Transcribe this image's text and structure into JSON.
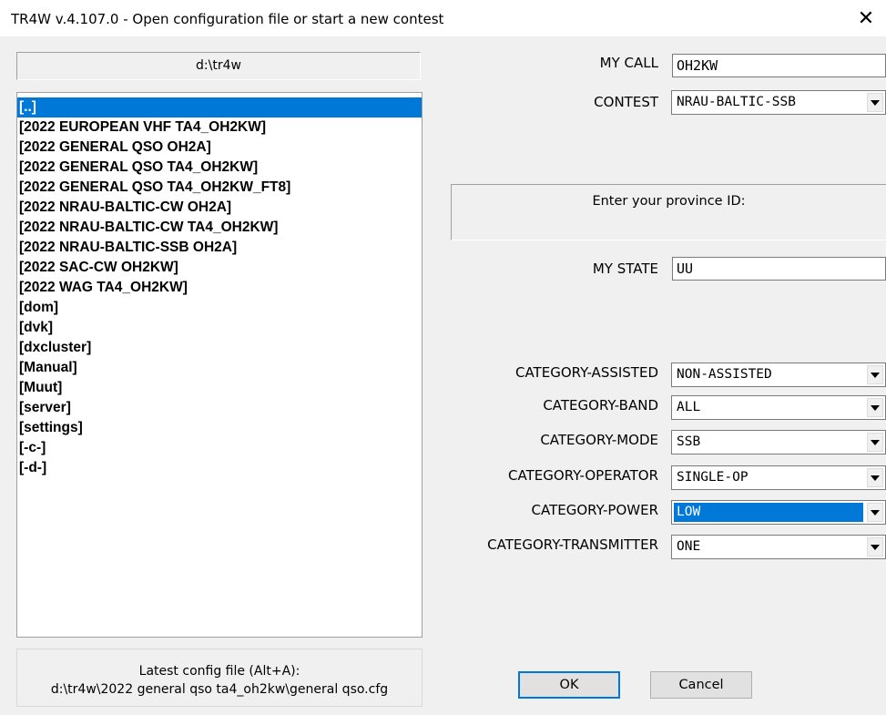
{
  "window": {
    "title": "TR4W v.4.107.0 - Open configuration file or start a new contest"
  },
  "path": "d:\\tr4w",
  "files": [
    {
      "name": "[..]",
      "selected": true
    },
    {
      "name": "[2022 EUROPEAN VHF TA4_OH2KW]",
      "selected": false
    },
    {
      "name": "[2022 GENERAL QSO OH2A]",
      "selected": false
    },
    {
      "name": "[2022 GENERAL QSO TA4_OH2KW]",
      "selected": false
    },
    {
      "name": "[2022 GENERAL QSO TA4_OH2KW_FT8]",
      "selected": false
    },
    {
      "name": "[2022 NRAU-BALTIC-CW OH2A]",
      "selected": false
    },
    {
      "name": "[2022 NRAU-BALTIC-CW TA4_OH2KW]",
      "selected": false
    },
    {
      "name": "[2022 NRAU-BALTIC-SSB OH2A]",
      "selected": false
    },
    {
      "name": "[2022 SAC-CW OH2KW]",
      "selected": false
    },
    {
      "name": "[2022 WAG TA4_OH2KW]",
      "selected": false
    },
    {
      "name": "[dom]",
      "selected": false
    },
    {
      "name": "[dvk]",
      "selected": false
    },
    {
      "name": "[dxcluster]",
      "selected": false
    },
    {
      "name": "[Manual]",
      "selected": false
    },
    {
      "name": "[Muut]",
      "selected": false
    },
    {
      "name": "[server]",
      "selected": false
    },
    {
      "name": "[settings]",
      "selected": false
    },
    {
      "name": "[-c-]",
      "selected": false
    },
    {
      "name": "[-d-]",
      "selected": false
    }
  ],
  "latest": {
    "label": "Latest config file (Alt+A):",
    "path": "d:\\tr4w\\2022 general qso ta4_oh2kw\\general qso.cfg"
  },
  "form": {
    "mycall_label": "MY CALL",
    "mycall_value": "OH2KW",
    "contest_label": "CONTEST",
    "contest_value": "NRAU-BALTIC-SSB",
    "province_prompt": "Enter your province ID:",
    "mystate_label": "MY STATE",
    "mystate_value": "UU"
  },
  "categories": [
    {
      "label": "CATEGORY-ASSISTED",
      "value": "NON-ASSISTED",
      "highlighted": false
    },
    {
      "label": "CATEGORY-BAND",
      "value": "ALL",
      "highlighted": false
    },
    {
      "label": "CATEGORY-MODE",
      "value": "SSB",
      "highlighted": false
    },
    {
      "label": "CATEGORY-OPERATOR",
      "value": "SINGLE-OP",
      "highlighted": false
    },
    {
      "label": "CATEGORY-POWER",
      "value": "LOW",
      "highlighted": true
    },
    {
      "label": "CATEGORY-TRANSMITTER",
      "value": "ONE",
      "highlighted": false
    }
  ],
  "buttons": {
    "ok": "OK",
    "cancel": "Cancel"
  },
  "colors": {
    "selection": "#0078d7",
    "dialog_bg": "#f0f0f0"
  }
}
